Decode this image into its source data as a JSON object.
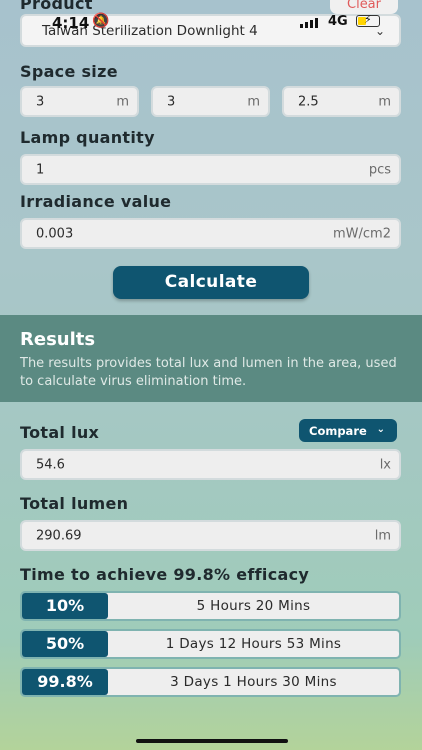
{
  "status_bar": {
    "time": "4:14",
    "network": "4G",
    "bell_icon": "bell-slash-icon",
    "battery_level": 0.4
  },
  "product": {
    "label": "Product",
    "value": "Taiwan Sterilization Downlight 4",
    "clear_label": "Clear"
  },
  "space_size": {
    "label": "Space size",
    "fields": [
      {
        "value": "3",
        "unit": "m"
      },
      {
        "value": "3",
        "unit": "m"
      },
      {
        "value": "2.5",
        "unit": "m"
      }
    ]
  },
  "lamp_quantity": {
    "label": "Lamp quantity",
    "value": "1",
    "unit": "pcs"
  },
  "irradiance": {
    "label": "Irradiance value",
    "value": "0.003",
    "unit": "mW/cm2"
  },
  "calculate_label": "Calculate",
  "results": {
    "title": "Results",
    "description": "The results provides total lux and lumen in the area, used to calculate virus elimination time."
  },
  "total_lux": {
    "label": "Total lux",
    "value": "54.6",
    "unit": "lx",
    "compare_label": "Compare"
  },
  "total_lumen": {
    "label": "Total lumen",
    "value": "290.69",
    "unit": "lm"
  },
  "efficacy": {
    "label": "Time to achieve 99.8% efficacy",
    "rows": [
      {
        "percent": "10%",
        "time": "5 Hours 20 Mins"
      },
      {
        "percent": "50%",
        "time": "1 Days 12 Hours 53 Mins"
      },
      {
        "percent": "99.8%",
        "time": "3 Days 1 Hours 30 Mins"
      }
    ]
  },
  "colors": {
    "primary": "#0f5570",
    "results_band": "#5b8a82",
    "clear_text": "#e05a5a",
    "row_border": "#7fb3b0"
  }
}
